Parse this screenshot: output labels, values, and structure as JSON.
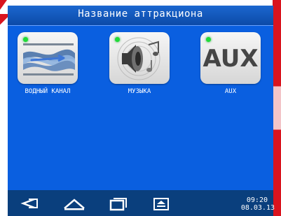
{
  "header": {
    "title": "Название аттракциона"
  },
  "tiles": [
    {
      "label": "ВОДНЫЙ КАНАЛ",
      "icon": "water-waves-icon",
      "status_color": "#1fdc38"
    },
    {
      "label": "МУЗЫКА",
      "icon": "speaker-icon",
      "status_color": "#1fdc38"
    },
    {
      "label": "AUX",
      "icon_text": "AUX",
      "status_color": "#1fdc38"
    }
  ],
  "navbar": {
    "buttons": [
      "back-icon",
      "home-icon",
      "recent-apps-icon",
      "eject-icon"
    ],
    "time": "09:20",
    "date": "08.03.13"
  },
  "colors": {
    "background": "#0a5fe0",
    "header": "#0c4aa8",
    "navbar": "#0a3f7d",
    "brand_red": "#d9141e"
  }
}
